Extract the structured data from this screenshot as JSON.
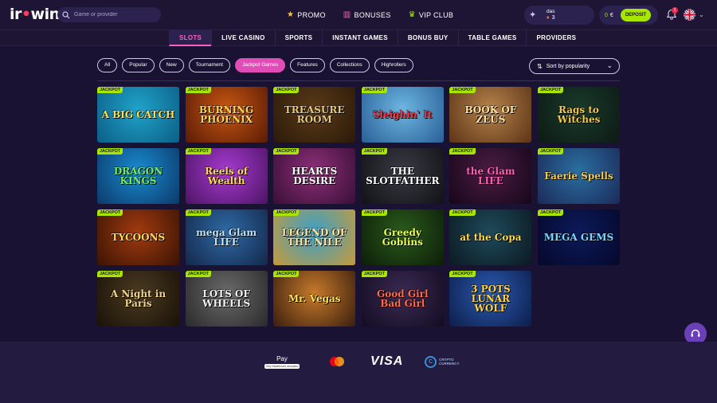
{
  "header": {
    "logo": "irwin",
    "search_placeholder": "Game or provider",
    "nav": [
      {
        "label": "PROMO",
        "icon": "star-icon"
      },
      {
        "label": "BONUSES",
        "icon": "gift-icon"
      },
      {
        "label": "VIP CLUB",
        "icon": "crown-icon"
      }
    ],
    "user": {
      "name": "das",
      "level": "3"
    },
    "wallet": {
      "balance": "0",
      "currency": "€",
      "deposit_label": "DEPOSIT"
    },
    "notifications_count": "1"
  },
  "categories": [
    {
      "label": "SLOTS",
      "active": true
    },
    {
      "label": "LIVE CASINO",
      "active": false
    },
    {
      "label": "SPORTS",
      "active": false
    },
    {
      "label": "INSTANT GAMES",
      "active": false
    },
    {
      "label": "BONUS BUY",
      "active": false
    },
    {
      "label": "TABLE GAMES",
      "active": false
    },
    {
      "label": "PROVIDERS",
      "active": false
    }
  ],
  "filters": [
    {
      "label": "All",
      "active": false
    },
    {
      "label": "Popular",
      "active": false
    },
    {
      "label": "New",
      "active": false
    },
    {
      "label": "Tournament",
      "active": false
    },
    {
      "label": "Jackpot Games",
      "active": true
    },
    {
      "label": "Features",
      "active": false
    },
    {
      "label": "Collections",
      "active": false
    },
    {
      "label": "Highrollers",
      "active": false
    }
  ],
  "sort": {
    "label": "Sort by popularity"
  },
  "jackpot_badge": "JACKPOT",
  "games": [
    {
      "title": "A BIG CATCH",
      "bg": "#1fa3c9",
      "bg2": "#0c5e86",
      "fg": "#ffe14a"
    },
    {
      "title": "BURNING PHOENIX",
      "bg": "#c75612",
      "bg2": "#5a1b06",
      "fg": "#ffd45a"
    },
    {
      "title": "TREASURE ROOM",
      "bg": "#5a3a17",
      "bg2": "#2b1a09",
      "fg": "#e7c778"
    },
    {
      "title": "Sleighin' It",
      "bg": "#6cb6e2",
      "bg2": "#2a5f96",
      "fg": "#ff2c3c"
    },
    {
      "title": "BOOK OF ZEUS",
      "bg": "#b5824a",
      "bg2": "#5c3417",
      "fg": "#ffe19a"
    },
    {
      "title": "Rags to Witches",
      "bg": "#1a3a2a",
      "bg2": "#0c1a14",
      "fg": "#f3c84a"
    },
    {
      "title": "DRAGON KINGS",
      "bg": "#1a8ad0",
      "bg2": "#0b3a6a",
      "fg": "#77e86a"
    },
    {
      "title": "Reels of Wealth",
      "bg": "#a63ad0",
      "bg2": "#4d1464",
      "fg": "#ffd860"
    },
    {
      "title": "HEARTS DESIRE",
      "bg": "#8c2f78",
      "bg2": "#3a0f36",
      "fg": "#ffffff"
    },
    {
      "title": "THE SLOTFATHER",
      "bg": "#3a3a44",
      "bg2": "#111116",
      "fg": "#ffffff"
    },
    {
      "title": "the Glam LIFE",
      "bg": "#4a1d42",
      "bg2": "#17061a",
      "fg": "#ff5fb8"
    },
    {
      "title": "Faerie Spells",
      "bg": "#2a6fa0",
      "bg2": "#1b2a5a",
      "fg": "#f5c84a"
    },
    {
      "title": "TYCOONS",
      "bg": "#a23a0f",
      "bg2": "#3a1404",
      "fg": "#ffd85a"
    },
    {
      "title": "mega Glam LIFE",
      "bg": "#2e6aa6",
      "bg2": "#14284a",
      "fg": "#bfe6ff"
    },
    {
      "title": "LEGEND OF THE NILE",
      "bg": "#3aa0c8",
      "bg2": "#c79a3a",
      "fg": "#ffe8a0"
    },
    {
      "title": "Greedy Goblins",
      "bg": "#2a5a1c",
      "bg2": "#0d1e08",
      "fg": "#e8ff50"
    },
    {
      "title": "at the Copa",
      "bg": "#1e4a5a",
      "bg2": "#0b1a22",
      "fg": "#ffd84a"
    },
    {
      "title": "MEGA GEMS",
      "bg": "#0c1a5a",
      "bg2": "#05082a",
      "fg": "#7ad8ff"
    },
    {
      "title": "A Night in Paris",
      "bg": "#4a3a20",
      "bg2": "#1a1208",
      "fg": "#f0d48a"
    },
    {
      "title": "LOTS OF WHEELS",
      "bg": "#6a6a6a",
      "bg2": "#2a2a2a",
      "fg": "#f2f2f2"
    },
    {
      "title": "Mr. Vegas",
      "bg": "#c77a2a",
      "bg2": "#3a1e0e",
      "fg": "#ffe15a"
    },
    {
      "title": "Good Girl Bad Girl",
      "bg": "#3a2a52",
      "bg2": "#140c22",
      "fg": "#ff6a4a"
    },
    {
      "title": "3 POTS LUNAR WOLF",
      "bg": "#2a5ab0",
      "bg2": "#0d1d4a",
      "fg": "#ffd24a"
    }
  ],
  "footer": {
    "apple_pay": "Pay",
    "apple_pay_note": "Only Mastercard accepted",
    "visa": "VISA",
    "crypto_line1": "CRYPTO",
    "crypto_line2": "CURRENCY"
  }
}
